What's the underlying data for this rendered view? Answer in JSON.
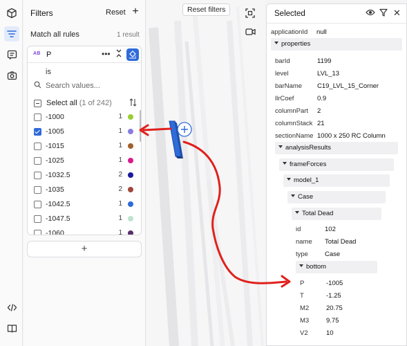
{
  "rail": {
    "icons": [
      "cube-icon",
      "filter-icon",
      "comment-icon",
      "camera-icon"
    ],
    "bottom_icons": [
      "code-icon",
      "book-icon"
    ]
  },
  "filters": {
    "title": "Filters",
    "reset_label": "Reset",
    "add_label": "+",
    "match_label": "Match all rules",
    "result_count": "1 result",
    "rule": {
      "type_badge": "AB",
      "field": "P",
      "operator": "is",
      "search_placeholder": "Search values...",
      "select_all_label": "Select all",
      "select_all_count": "(1 of 242)",
      "values": [
        {
          "value": "-1000",
          "count": "1",
          "color": "#9acd32",
          "checked": false
        },
        {
          "value": "-1005",
          "count": "1",
          "color": "#8a7be0",
          "checked": true
        },
        {
          "value": "-1015",
          "count": "1",
          "color": "#a0612b",
          "checked": false
        },
        {
          "value": "-1025",
          "count": "1",
          "color": "#d81b8c",
          "checked": false
        },
        {
          "value": "-1032.5",
          "count": "2",
          "color": "#1a1a9e",
          "checked": false
        },
        {
          "value": "-1035",
          "count": "2",
          "color": "#a0483a",
          "checked": false
        },
        {
          "value": "-1042.5",
          "count": "1",
          "color": "#2f6bd9",
          "checked": false
        },
        {
          "value": "-1047.5",
          "count": "1",
          "color": "#bfe3cf",
          "checked": false
        },
        {
          "value": "-1060",
          "count": "1",
          "color": "#5a2e6a",
          "checked": false
        }
      ]
    },
    "add_rule_label": "+"
  },
  "viewport": {
    "reset_filters_label": "Reset filters",
    "tools": [
      "focus-icon",
      "video-icon"
    ]
  },
  "selected": {
    "title": "Selected",
    "application_key": "applicationId",
    "application_val": "null",
    "properties_label": "properties",
    "properties": [
      {
        "key": "barId",
        "val": "1199"
      },
      {
        "key": "level",
        "val": "LVL_13"
      },
      {
        "key": "barName",
        "val": "C19_LVL_15_Corner"
      },
      {
        "key": "llrCoef",
        "val": "0.9"
      },
      {
        "key": "columnPart",
        "val": "2"
      },
      {
        "key": "columnStack",
        "val": "21"
      },
      {
        "key": "sectionName",
        "val": "1000 x 250 RC Column"
      }
    ],
    "analysis_label": "analysisResults",
    "frame_label": "frameForces",
    "model_label": "model_1",
    "case_label": "Case",
    "total_dead_label": "Total Dead",
    "case_props": [
      {
        "key": "id",
        "val": "102"
      },
      {
        "key": "name",
        "val": "Total Dead"
      },
      {
        "key": "type",
        "val": "Case"
      }
    ],
    "bottom_label": "bottom",
    "bottom_props": [
      {
        "key": "P",
        "val": "-1005"
      },
      {
        "key": "T",
        "val": "-1.25"
      },
      {
        "key": "M2",
        "val": "20.75"
      },
      {
        "key": "M3",
        "val": "9.75"
      },
      {
        "key": "V2",
        "val": "10"
      }
    ]
  },
  "annotation_color": "#e0201b"
}
